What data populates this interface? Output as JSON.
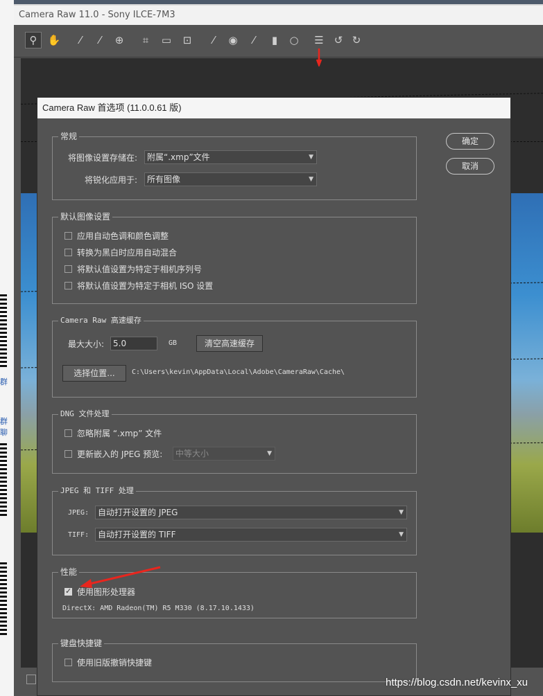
{
  "cr_window": {
    "title": "Camera Raw 11.0  -  Sony ILCE-7M3",
    "tools": [
      {
        "icon": "zoom-icon",
        "glyph": "⚲"
      },
      {
        "icon": "hand-icon",
        "glyph": "✋"
      },
      {
        "icon": "white-balance-icon",
        "glyph": "⁄"
      },
      {
        "icon": "color-sampler-icon",
        "glyph": "⁄"
      },
      {
        "icon": "targeted-adjustment-icon",
        "glyph": "⊕"
      },
      {
        "icon": "crop-icon",
        "glyph": "⌗"
      },
      {
        "icon": "straighten-icon",
        "glyph": "▭"
      },
      {
        "icon": "transform-icon",
        "glyph": "⊡"
      },
      {
        "icon": "spot-removal-icon",
        "glyph": "⁄"
      },
      {
        "icon": "red-eye-icon",
        "glyph": "◉"
      },
      {
        "icon": "adjustment-brush-icon",
        "glyph": "⁄"
      },
      {
        "icon": "graduated-filter-icon",
        "glyph": "▮"
      },
      {
        "icon": "radial-filter-icon",
        "glyph": "○"
      },
      {
        "icon": "preferences-icon",
        "glyph": "☰"
      },
      {
        "icon": "rotate-left-icon",
        "glyph": "↺"
      },
      {
        "icon": "rotate-right-icon",
        "glyph": "↻"
      }
    ]
  },
  "dialog": {
    "title": "Camera Raw 首选项 (11.0.0.61 版)",
    "ok_label": "确定",
    "cancel_label": "取消",
    "general": {
      "legend": "常规",
      "save_label": "将图像设置存储在:",
      "save_value": "附属“.xmp”文件",
      "sharpen_label": "将锐化应用于:",
      "sharpen_value": "所有图像"
    },
    "defaults": {
      "legend": "默认图像设置",
      "options": [
        {
          "label": "应用自动色调和颜色调整",
          "checked": false
        },
        {
          "label": "转换为黑白时应用自动混合",
          "checked": false
        },
        {
          "label": "将默认值设置为特定于相机序列号",
          "checked": false
        },
        {
          "label": "将默认值设置为特定于相机 ISO 设置",
          "checked": false
        }
      ]
    },
    "cache": {
      "legend": "Camera Raw 高速缓存",
      "max_label": "最大大小:",
      "max_value": "5.0",
      "unit": "GB",
      "purge_label": "清空高速缓存",
      "select_label": "选择位置...",
      "path": "C:\\Users\\kevin\\AppData\\Local\\Adobe\\CameraRaw\\Cache\\"
    },
    "dng": {
      "legend": "DNG 文件处理",
      "ignore_label": "忽略附属 “.xmp” 文件",
      "update_label": "更新嵌入的 JPEG 预览:",
      "preview_size": "中等大小"
    },
    "jpeg_tiff": {
      "legend": "JPEG 和 TIFF 处理",
      "jpeg_label": "JPEG:",
      "jpeg_value": "自动打开设置的 JPEG",
      "tiff_label": "TIFF:",
      "tiff_value": "自动打开设置的 TIFF"
    },
    "performance": {
      "legend": "性能",
      "gpu_label": "使用图形处理器",
      "gpu_checked": true,
      "directx": "DirectX: AMD Radeon(TM) R5 M330 (8.17.10.1433)"
    },
    "shortcuts": {
      "legend": "键盘快捷键",
      "legacy_label": "使用旧版撤销快捷键"
    }
  },
  "background": {
    "side_texts": [
      "群",
      "群聊"
    ]
  },
  "watermark": "https://blog.csdn.net/kevinx_xu",
  "colors": {
    "annotation_red": "#e8261e",
    "panel": "#535353",
    "titlebar": "#f2f2f2"
  }
}
